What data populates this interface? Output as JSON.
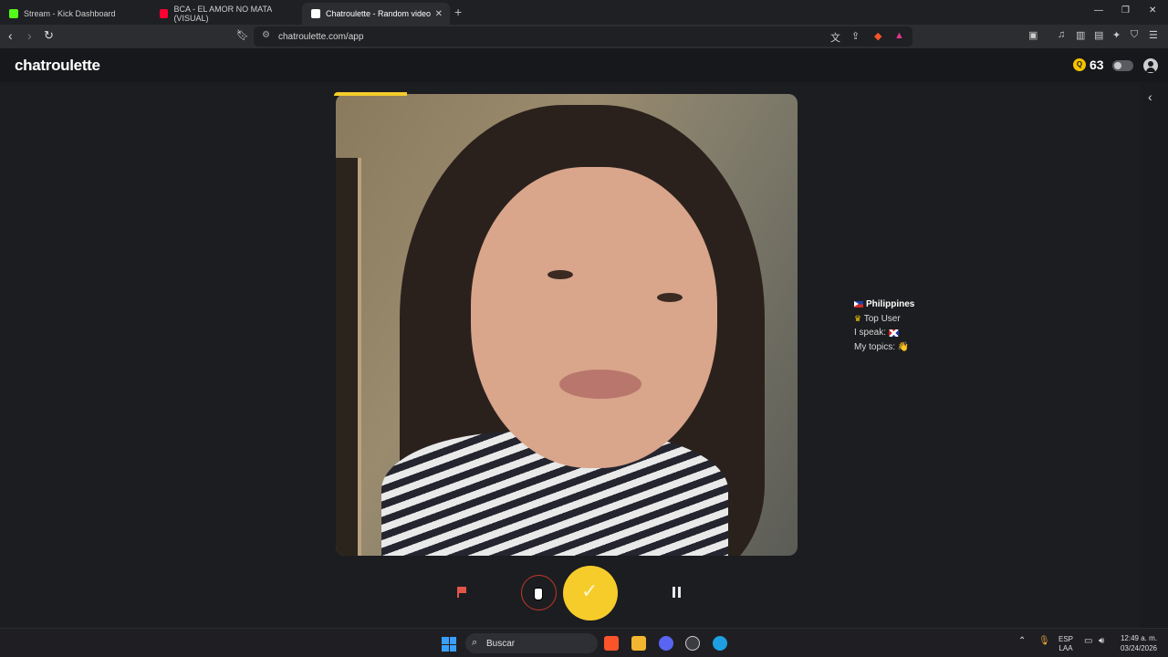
{
  "browser": {
    "tabs": [
      {
        "title": "Stream - Kick Dashboard",
        "active": false,
        "color": "#53fc18"
      },
      {
        "title": "BCA - EL AMOR NO MATA (VISUAL)",
        "active": false,
        "color": "#ff0033"
      },
      {
        "title": "Chatroulette - Random video",
        "active": true,
        "color": "#ffffff"
      }
    ],
    "new_tab_icon": "plus-icon",
    "url": "chatroulette.com/app",
    "window_controls": [
      "minimize-icon",
      "restore-icon",
      "close-icon"
    ]
  },
  "app": {
    "logo": "chatroulette",
    "coin_symbol": "Q",
    "coin_count": "63",
    "accent_color": "#f6cc2b"
  },
  "partner": {
    "country": "Philippines",
    "badge": "Top User",
    "speaks_label": "I speak:",
    "topics_label": "My topics:",
    "topics_emoji": "👋"
  },
  "controls": {
    "report_icon": "flag-icon",
    "skip_icon": "chevron-down-icon",
    "accept_icon": "check-icon",
    "pause_icon": "pause-icon"
  },
  "taskbar": {
    "search_placeholder": "Buscar",
    "lang_top": "ESP",
    "lang_bottom": "LAA",
    "time": "12:49 a. m.",
    "date": "03/24/2026"
  }
}
